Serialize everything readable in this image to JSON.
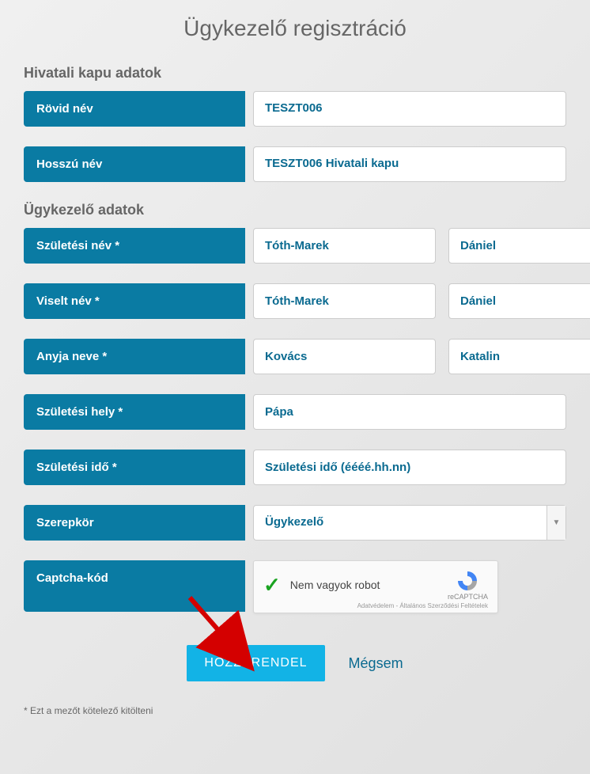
{
  "title": "Ügykezelő regisztráció",
  "sections": {
    "hivatali": {
      "heading": "Hivatali kapu adatok",
      "rovid_nev_label": "Rövid név",
      "rovid_nev_value": "TESZT006",
      "hosszu_nev_label": "Hosszú név",
      "hosszu_nev_value": "TESZT006 Hivatali kapu"
    },
    "ugykezelo": {
      "heading": "Ügykezelő adatok",
      "szuletesi_nev_label": "Születési név *",
      "szuletesi_nev_1": "Tóth-Marek",
      "szuletesi_nev_2": "Dániel",
      "viselt_nev_label": "Viselt név *",
      "viselt_nev_1": "Tóth-Marek",
      "viselt_nev_2": "Dániel",
      "anyja_neve_label": "Anyja neve *",
      "anyja_neve_1": "Kovács",
      "anyja_neve_2": "Katalin",
      "szuletesi_hely_label": "Születési hely *",
      "szuletesi_hely_value": "Pápa",
      "szuletesi_ido_label": "Születési idő *",
      "szuletesi_ido_placeholder": "Születési idő (éééé.hh.nn)",
      "szerepkor_label": "Szerepkör",
      "szerepkor_value": "Ügykezelő",
      "captcha_label": "Captcha-kód",
      "captcha_text": "Nem vagyok robot",
      "captcha_brand": "reCAPTCHA",
      "captcha_footer": "Adatvédelem - Általános Szerződési Feltételek"
    }
  },
  "buttons": {
    "submit": "HOZZÁRENDEL",
    "cancel": "Mégsem"
  },
  "footnote": "* Ezt a mezőt kötelező kitölteni"
}
